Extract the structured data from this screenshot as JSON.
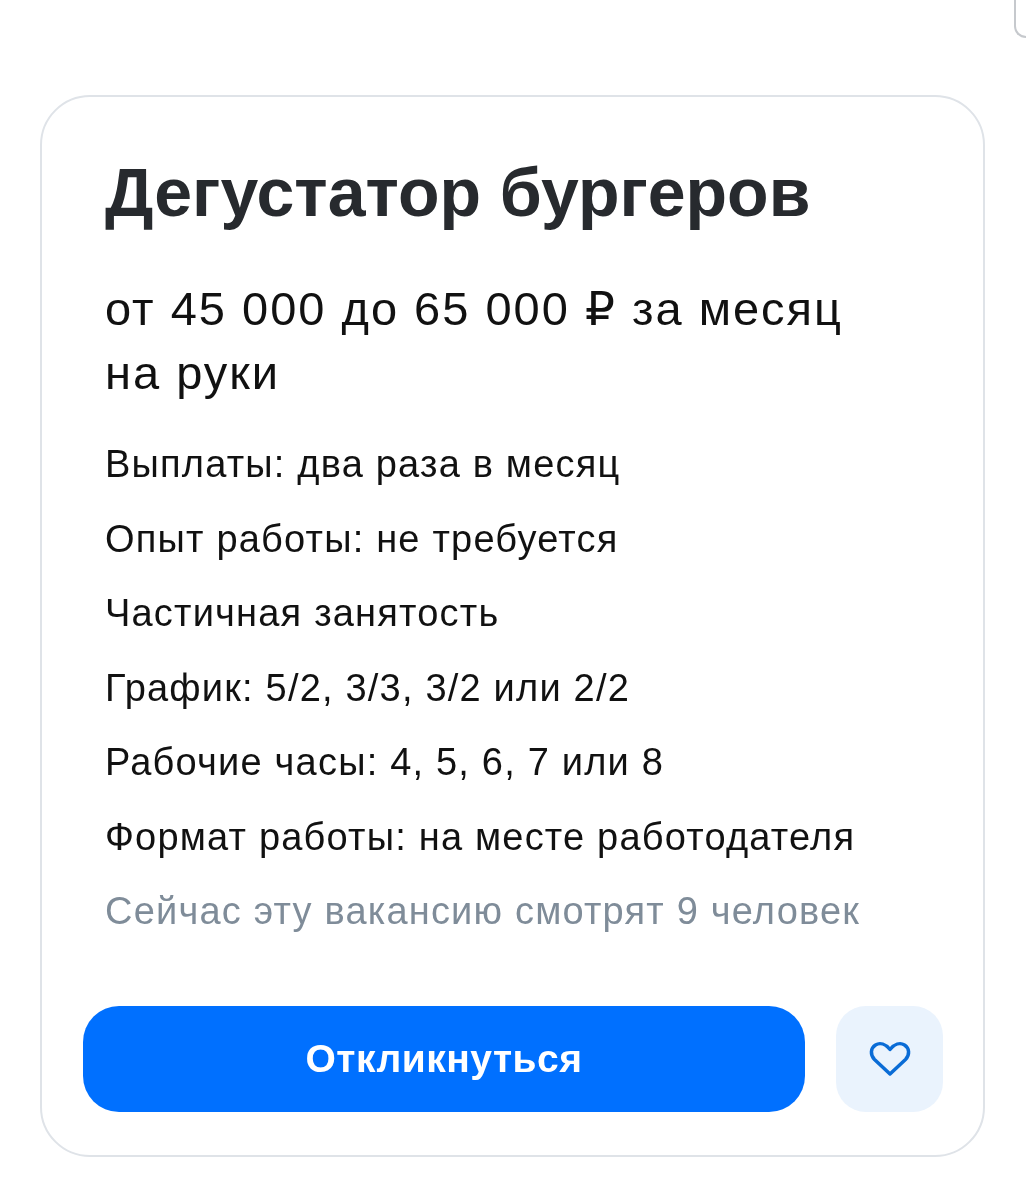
{
  "vacancy": {
    "title": "Дегустатор бургеров",
    "salary": "от 45 000 до 65 000 ₽ за месяц на руки",
    "details": [
      "Выплаты: два раза в месяц",
      "Опыт работы: не требуется",
      "Частичная занятость",
      "График: 5/2, 3/3, 3/2 или 2/2",
      "Рабочие часы: 4, 5, 6, 7 или 8",
      "Формат работы: на месте работодателя"
    ],
    "viewers": "Сейчас эту вакансию смотрят 9 человек"
  },
  "actions": {
    "apply_button": "Откликнуться",
    "favorite": {
      "on": false
    }
  }
}
